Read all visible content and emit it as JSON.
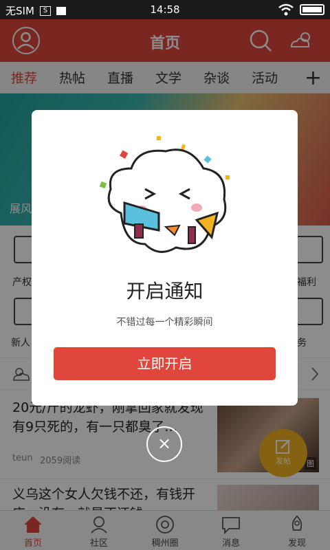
{
  "statusbar": {
    "carrier": "无SIM",
    "sim_icon_text": "S",
    "time": "14:58"
  },
  "header": {
    "title": "首页"
  },
  "tabs": [
    {
      "label": "推荐"
    },
    {
      "label": "热帖"
    },
    {
      "label": "直播"
    },
    {
      "label": "文学"
    },
    {
      "label": "杂谈"
    },
    {
      "label": "活动"
    }
  ],
  "tab_plus": "+",
  "banner": {
    "caption": "展风"
  },
  "grid": {
    "items": [
      "产权",
      "福利",
      "新人",
      "务"
    ]
  },
  "articles": [
    {
      "title": "20元/斤的龙虾，刚拿回家就发现有9只死的，有一只都臭了…",
      "author": "teun",
      "reads": "2059阅读",
      "thumb_tag": "图"
    },
    {
      "title": "义乌这个女人欠钱不还，有钱开店，没有，就是不还钱"
    }
  ],
  "fab": {
    "label": "发帖"
  },
  "bottomnav": [
    {
      "label": "首页"
    },
    {
      "label": "社区"
    },
    {
      "label": "稠州圈"
    },
    {
      "label": "消息"
    },
    {
      "label": "发现"
    }
  ],
  "dialog": {
    "title": "开启通知",
    "subtitle": "不错过每一个精彩瞬间",
    "button": "立即开启",
    "close": "×"
  },
  "colors": {
    "accent": "#e0473c",
    "fab": "#f2b320"
  }
}
